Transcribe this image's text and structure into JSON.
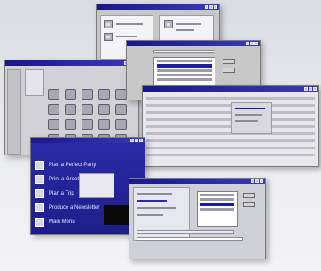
{
  "menu_window": {
    "items": [
      {
        "label": "Plan a Perfect Party",
        "icon": "plain-square-icon"
      },
      {
        "label": "Print a Greeting Card",
        "icon": "plain-square-icon"
      },
      {
        "label": "Plan a Trip",
        "icon": "plain-square-icon"
      },
      {
        "label": "Produce a Newsletter",
        "icon": "plain-square-icon"
      },
      {
        "label": "Main Menu",
        "icon": "plain-square-icon"
      }
    ]
  },
  "colors": {
    "title_bar": "#18188a",
    "menu_background": "#26269a",
    "window_face": "#c8c8c8",
    "highlight": "#1c1ca0"
  }
}
